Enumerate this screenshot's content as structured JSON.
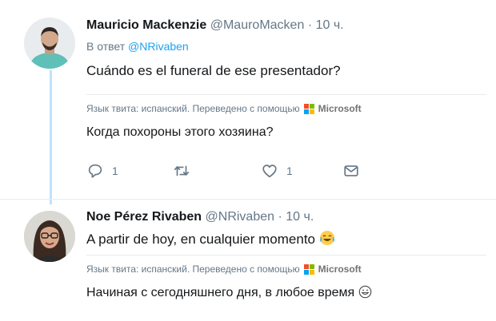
{
  "tweets": [
    {
      "name": "Mauricio Mackenzie",
      "handle": "@MauroMacken",
      "separator": "·",
      "time": "10 ч.",
      "reply_prefix": "В ответ",
      "reply_mention": "@NRivaben",
      "text": "Cuándo es el funeral de ese presentador?",
      "translation_note": "Язык твита: испанский. Переведено с помощью",
      "translation_brand": "Microsoft",
      "translation": "Когда похороны этого хозяина?",
      "actions": {
        "reply_count": "1",
        "retweet_count": "",
        "like_count": "1"
      },
      "icons": [
        "reply-icon",
        "retweet-icon",
        "like-icon",
        "message-icon"
      ]
    },
    {
      "name": "Noe Pérez Rivaben",
      "handle": "@NRivaben",
      "separator": "·",
      "time": "10 ч.",
      "text": "A partir de hoy, en cualquier momento",
      "text_emoji": "face-with-tears-of-joy",
      "translation_note": "Язык твита: испанский. Переведено с помощью",
      "translation_brand": "Microsoft",
      "translation": "Начиная с сегодняшнего дня, в любое время",
      "translation_emoji": "grinning-face"
    }
  ],
  "colors": {
    "accent": "#1da1f2",
    "connector": "#bfe2fb",
    "muted": "#657786",
    "ms_red": "#f25022",
    "ms_green": "#7fba00",
    "ms_blue": "#00a4ef",
    "ms_yellow": "#ffb900"
  }
}
